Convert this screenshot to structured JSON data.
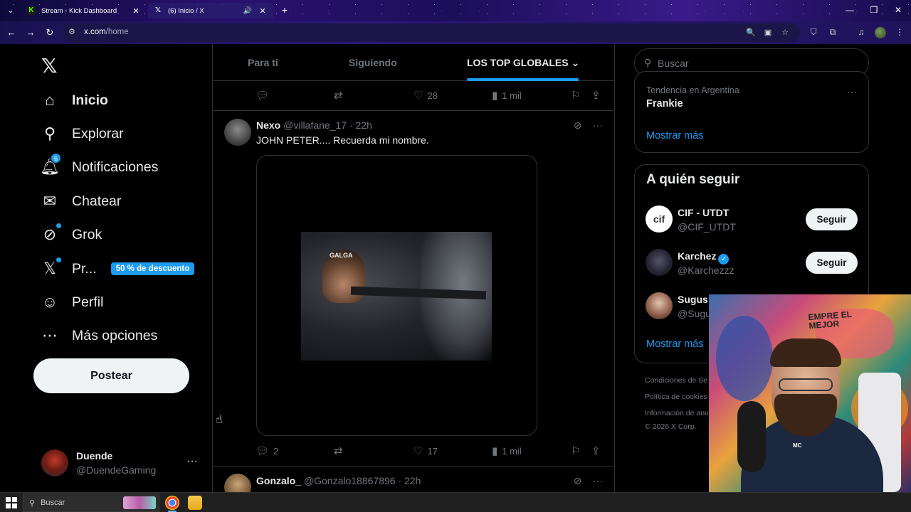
{
  "browser": {
    "tabs": [
      {
        "title": "Stream - Kick Dashboard",
        "favicon": "kick-icon",
        "active": false
      },
      {
        "title": "(6) Inicio / X",
        "favicon": "x-icon",
        "active": true
      }
    ],
    "url_domain": "x.com",
    "url_path": "/home"
  },
  "sidebar": {
    "items": [
      {
        "label": "Inicio",
        "icon": "home-icon",
        "active": true
      },
      {
        "label": "Explorar",
        "icon": "search-icon"
      },
      {
        "label": "Notificaciones",
        "icon": "bell-icon",
        "badge": "6"
      },
      {
        "label": "Chatear",
        "icon": "mail-icon"
      },
      {
        "label": "Grok",
        "icon": "grok-icon"
      },
      {
        "label": "Pr...",
        "icon": "x-premium-icon",
        "promo": "50 % de descuento"
      },
      {
        "label": "Perfil",
        "icon": "person-icon"
      },
      {
        "label": "Más opciones",
        "icon": "more-circle-icon"
      }
    ],
    "post_button": "Postear",
    "account": {
      "name": "Duende",
      "handle": "@DuendeGaming"
    }
  },
  "feed": {
    "tabs": [
      "Para ti",
      "Siguiendo",
      "LOS TOP GLOBALES"
    ],
    "active_tab": "LOS TOP GLOBALES",
    "prev_tweet_actions": {
      "replies": "",
      "likes": "28",
      "views": "1 mil"
    },
    "tweets": [
      {
        "name": "Nexo",
        "handle": "@villafane_17",
        "time": "· 22h",
        "text": "JOHN PETER.... Recuerda mi nombre.",
        "media_caption": "GALGA",
        "replies": "2",
        "likes": "17",
        "views": "1 mil"
      },
      {
        "name": "Gonzalo_",
        "handle": "@Gonzalo18867896",
        "time": "· 22h"
      }
    ]
  },
  "right": {
    "search_placeholder": "Buscar",
    "trend": {
      "meta": "Tendencia en Argentina",
      "name": "Frankie"
    },
    "show_more": "Mostrar más",
    "who_to_follow": {
      "title": "A quién seguir",
      "accounts": [
        {
          "name": "CIF - UTDT",
          "handle": "@CIF_UTDT",
          "button": "Seguir",
          "avatar_text": "cif"
        },
        {
          "name": "Karchez",
          "handle": "@Karchezzz",
          "button": "Seguir",
          "verified": true
        },
        {
          "name": "Sugus",
          "handle": "@Sugu"
        }
      ],
      "show_more": "Mostrar más"
    },
    "footer": [
      "Condiciones de Se",
      "Política de cookies",
      "Información de anu",
      "© 2026 X Corp."
    ]
  },
  "webcam": {
    "wall_text_1": "EMPRE EL",
    "wall_text_2": "MEJOR",
    "shirt_text": "MC"
  },
  "taskbar": {
    "search_placeholder": "Buscar"
  },
  "colors": {
    "accent": "#1d9bf0",
    "background": "#000000",
    "border": "#2f3336",
    "muted": "#71767b"
  }
}
